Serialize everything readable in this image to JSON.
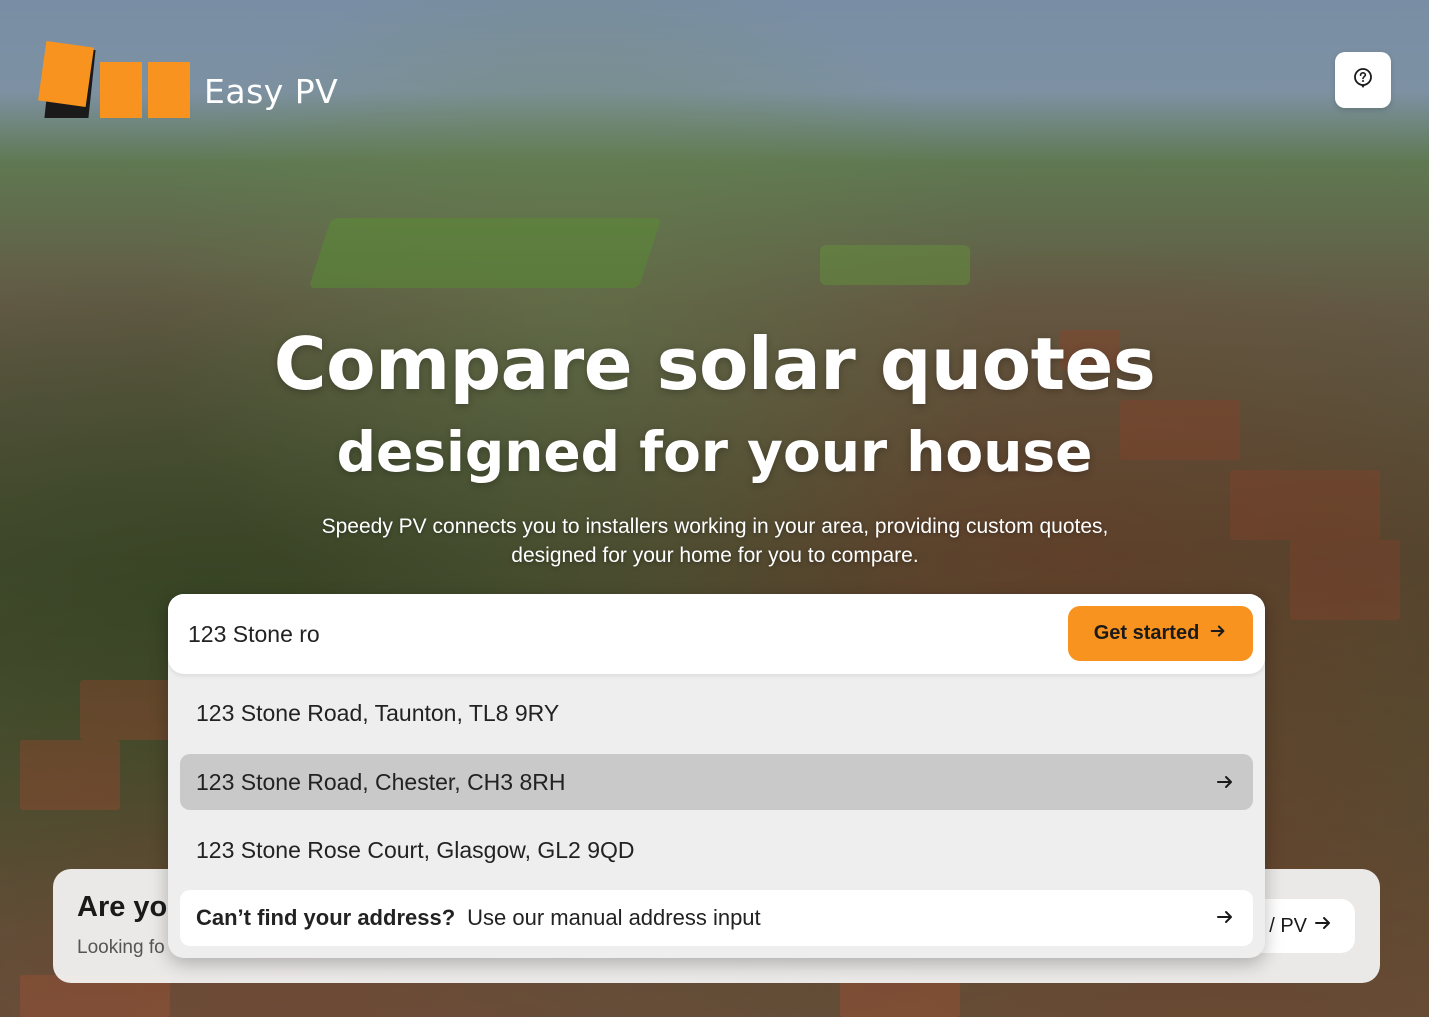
{
  "brand": {
    "name": "Easy PV",
    "accent": "#f7931e"
  },
  "header": {
    "help_icon": "help-circle-icon"
  },
  "hero": {
    "title": "Compare solar quotes",
    "subtitle": "designed for your house",
    "description": "Speedy PV connects you to installers working in your area, providing custom quotes, designed for your home for you to compare."
  },
  "search": {
    "value": "123 Stone ro",
    "button_label": "Get started",
    "suggestions": [
      "123 Stone Road, Taunton, TL8 9RY",
      "123 Stone Road, Chester, CH3 8RH",
      "123 Stone Rose Court, Glasgow, GL2 9QD"
    ],
    "active_index": 1,
    "manual": {
      "bold": "Can’t find your address?",
      "text": "Use our manual address input"
    }
  },
  "back_card": {
    "title": "Are yo",
    "subtitle": "Looking fo",
    "button_label": "/ PV"
  }
}
